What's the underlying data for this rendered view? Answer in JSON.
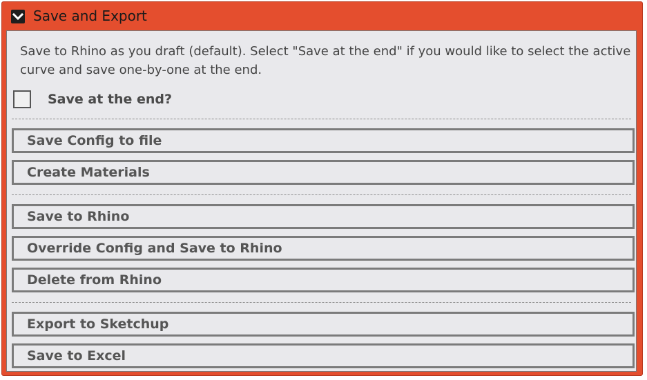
{
  "header": {
    "title": "Save and Export",
    "toggle_icon": "chevron-down-icon"
  },
  "description": "Save to Rhino as you draft (default). Select \"Save at the end\" if you would like to select the active curve and save one-by-one at the end.",
  "checkbox": {
    "label": "Save at the end?",
    "checked": false
  },
  "buttons": {
    "save_config": "Save Config to file",
    "create_materials": "Create Materials",
    "save_to_rhino": "Save to Rhino",
    "override_save": "Override Config and Save to Rhino",
    "delete_from_rhino": "Delete from Rhino",
    "export_sketchup": "Export to Sketchup",
    "save_excel": "Save to Excel"
  },
  "colors": {
    "header_accent": "#e44e2e",
    "panel_bg": "#e9e9ec",
    "button_border": "#7b7b7b"
  }
}
